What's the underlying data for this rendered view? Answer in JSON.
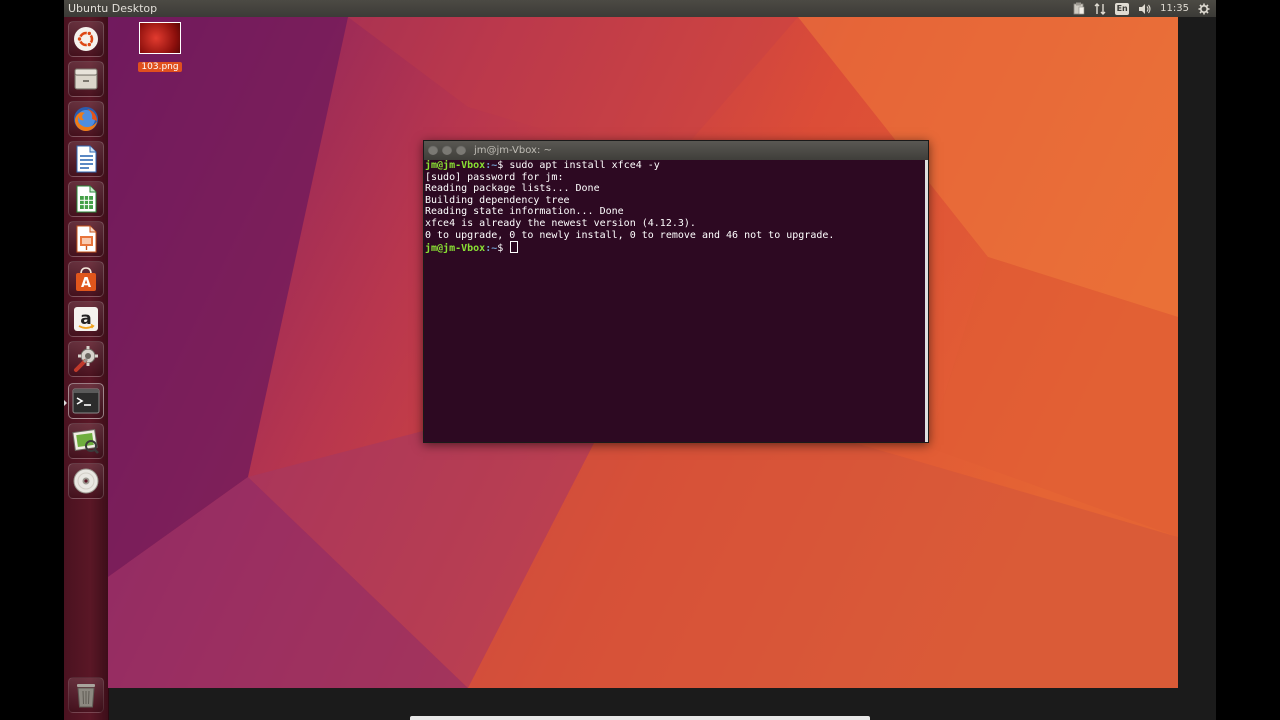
{
  "topbar": {
    "title": "Ubuntu Desktop",
    "keyboard_layout": "En",
    "clock": "11:35",
    "icons": [
      "clipboard-icon",
      "network-arrows-icon",
      "keyboard-icon",
      "volume-icon",
      "gear-icon"
    ]
  },
  "launcher": {
    "items": [
      {
        "name": "dash-home",
        "icon": "ubuntu-logo-icon"
      },
      {
        "name": "files",
        "icon": "file-cabinet-icon"
      },
      {
        "name": "firefox",
        "icon": "firefox-icon"
      },
      {
        "name": "libreoffice-writer",
        "icon": "writer-document-icon"
      },
      {
        "name": "libreoffice-calc",
        "icon": "calc-spreadsheet-icon"
      },
      {
        "name": "libreoffice-impress",
        "icon": "impress-presentation-icon"
      },
      {
        "name": "ubuntu-software",
        "icon": "software-bag-icon"
      },
      {
        "name": "amazon",
        "icon": "amazon-icon"
      },
      {
        "name": "system-settings",
        "icon": "settings-tools-icon"
      },
      {
        "name": "terminal",
        "icon": "terminal-icon",
        "active": true
      },
      {
        "name": "image-viewer",
        "icon": "image-viewer-icon"
      },
      {
        "name": "dvd",
        "icon": "disc-icon"
      },
      {
        "name": "trash",
        "icon": "trash-icon"
      }
    ],
    "amazon_letter": "a",
    "software_letter": "A"
  },
  "desktop": {
    "file": {
      "label": "103.png"
    }
  },
  "terminal": {
    "title": "jm@jm-Vbox: ~",
    "prompt_user": "jm@jm-Vbox",
    "prompt_path": ":~",
    "prompt_symbol": "$ ",
    "command": "sudo apt install xfce4 -y",
    "output": [
      "[sudo] password for jm:",
      "Reading package lists... Done",
      "Building dependency tree",
      "Reading state information... Done",
      "xfce4 is already the newest version (4.12.3).",
      "0 to upgrade, 0 to newly install, 0 to remove and 46 not to upgrade."
    ]
  },
  "colors": {
    "wallpaper_purple": "#7a1d63",
    "wallpaper_orange": "#e5602f",
    "terminal_bg": "#2d0922",
    "prompt_green": "#8ae234",
    "prompt_blue": "#729fcf",
    "panel_dark": "#3c3b37"
  }
}
